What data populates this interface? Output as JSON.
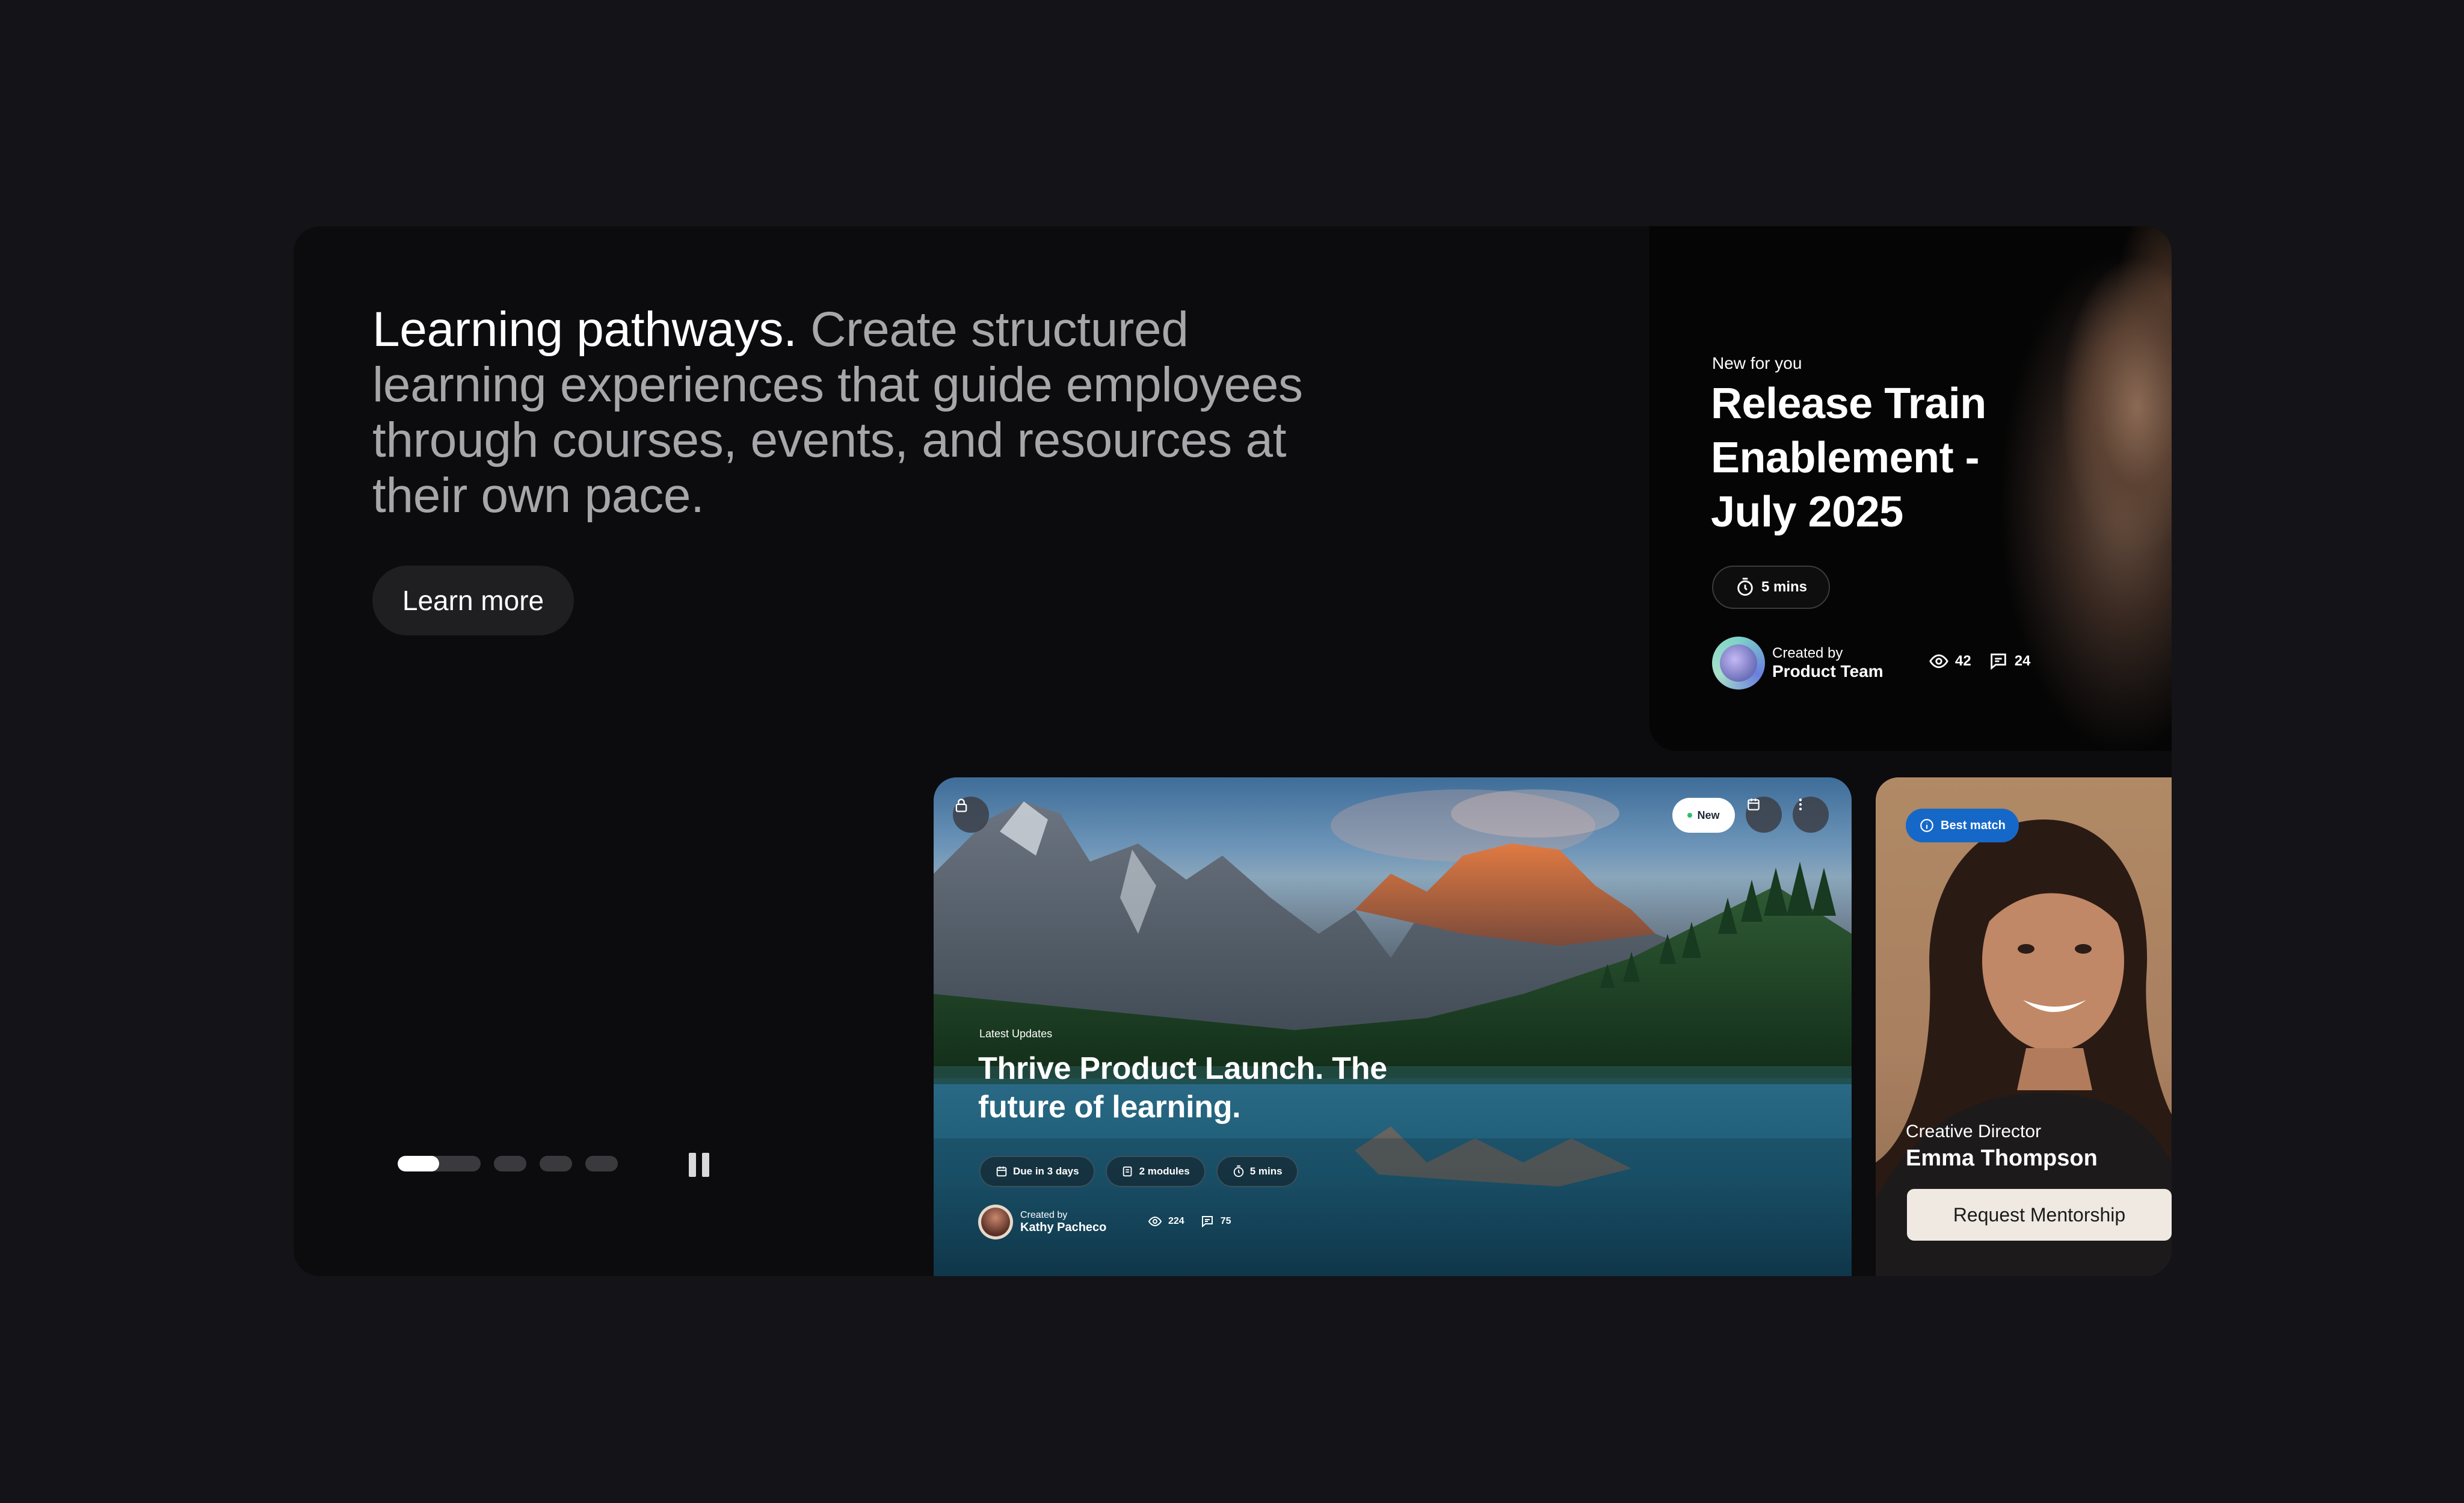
{
  "hero": {
    "headline_strong": "Learning pathways.",
    "headline_rest": "Create structured learning experiences that guide employees through courses, events, and resources at their own pace.",
    "cta_label": "Learn more"
  },
  "carousel": {
    "slide_count": 4,
    "active_index": 0,
    "active_progress": 0.5,
    "pause_label": "Pause"
  },
  "release_card": {
    "eyebrow": "New for you",
    "title": "Release Train Enablement -July 2025",
    "duration": "5 mins",
    "created_label": "Created by",
    "creator": "Product Team",
    "views": "42",
    "comments": "24"
  },
  "launch_card": {
    "badge": "New",
    "eyebrow": "Latest Updates",
    "title": "Thrive Product Launch. The future of learning.",
    "chips": [
      "Due in 3 days",
      "2 modules",
      "5 mins"
    ],
    "created_label": "Created by",
    "creator": "Kathy Pacheco",
    "views": "224",
    "comments": "75"
  },
  "mentor_card": {
    "badge": "Best match",
    "role": "Creative Director",
    "name": "Emma Thompson",
    "cta_label": "Request Mentorship"
  },
  "icons": {
    "lock": "lock-icon",
    "calendar": "calendar-icon",
    "more": "more-vertical-icon",
    "clock": "clock-icon",
    "eye": "eye-icon",
    "comment": "comment-icon",
    "info": "info-icon",
    "modules": "modules-icon",
    "pause": "pause-icon"
  },
  "colors": {
    "page_bg": "#141317",
    "panel_bg": "#0c0b0d",
    "best_match_blue": "#1668c8",
    "new_dot": "#2ebd6b"
  }
}
